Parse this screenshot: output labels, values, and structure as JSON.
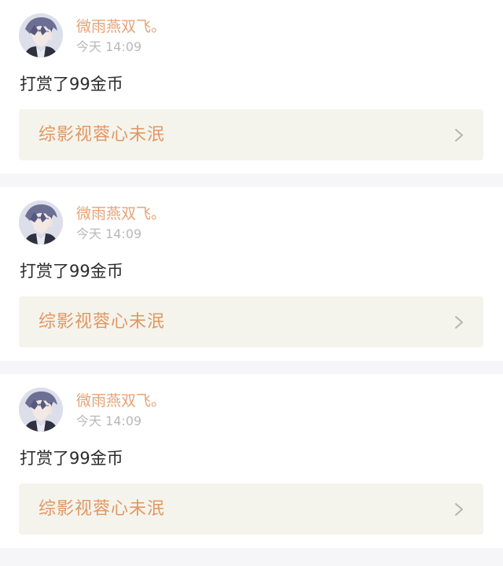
{
  "feed": {
    "items": [
      {
        "username": "微雨燕双飞。",
        "time": "今天 14:09",
        "message": "打赏了99金币",
        "book_title": "综影视蓉心未泯",
        "avatar_icon": "anime-avatar",
        "chevron_icon": "chevron-right-icon"
      },
      {
        "username": "微雨燕双飞。",
        "time": "今天 14:09",
        "message": "打赏了99金币",
        "book_title": "综影视蓉心未泯",
        "avatar_icon": "anime-avatar",
        "chevron_icon": "chevron-right-icon"
      },
      {
        "username": "微雨燕双飞。",
        "time": "今天 14:09",
        "message": "打赏了99金币",
        "book_title": "综影视蓉心未泯",
        "avatar_icon": "anime-avatar",
        "chevron_icon": "chevron-right-icon"
      }
    ]
  },
  "colors": {
    "username": "#e8a274",
    "book_title": "#e39763",
    "book_bg": "#f4f4ec",
    "timestamp": "#b9b9b9",
    "separator": "#f6f5f7"
  }
}
